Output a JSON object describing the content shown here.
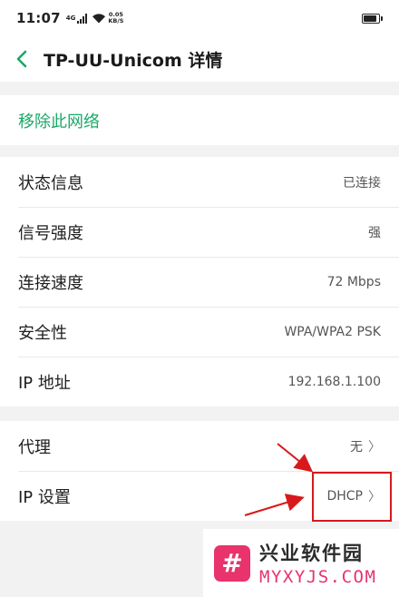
{
  "status_bar": {
    "time": "11:07",
    "network_type": "4G",
    "net_speed_value": "0.05",
    "net_speed_unit": "KB/S",
    "icons": [
      "cellular-signal-icon",
      "wifi-icon",
      "battery-icon"
    ],
    "battery_level": 0.85
  },
  "header": {
    "back_icon": "chevron-left-icon",
    "title": "TP-UU-Unicom 详情"
  },
  "remove_section": {
    "label": "移除此网络"
  },
  "info_section": {
    "rows": [
      {
        "label": "状态信息",
        "value": "已连接"
      },
      {
        "label": "信号强度",
        "value": "强"
      },
      {
        "label": "连接速度",
        "value": "72 Mbps"
      },
      {
        "label": "安全性",
        "value": "WPA/WPA2 PSK"
      },
      {
        "label": "IP 地址",
        "value": "192.168.1.100"
      }
    ]
  },
  "settings_section": {
    "rows": [
      {
        "label": "代理",
        "value": "无",
        "chevron": "〉"
      },
      {
        "label": "IP 设置",
        "value": "DHCP",
        "chevron": "〉"
      }
    ]
  },
  "watermark": {
    "logo_glyph": "#",
    "name_cn": "兴业软件园",
    "name_en": "MYXYJS.COM"
  },
  "colors": {
    "accent_green": "#1aa869",
    "annotation_red": "#d8191c",
    "watermark_pink": "#e8336d"
  }
}
